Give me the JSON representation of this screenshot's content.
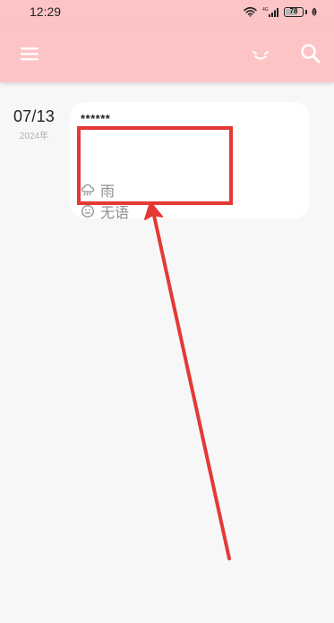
{
  "status_bar": {
    "time": "12:29",
    "network_label": "4G",
    "battery_level": "78",
    "battery_fraction": 0.78
  },
  "app_bar": {
    "background_color": "#fdc4c6"
  },
  "entry": {
    "date": "07/13",
    "year": "2024年",
    "content": "******",
    "weather": "雨",
    "mood": "无语"
  },
  "annotation": {
    "color": "#e53935"
  },
  "icons": {
    "menu": "menu-icon",
    "mood_filter": "mood-face-icon",
    "search": "search-icon",
    "weather": "cloud-rain-icon",
    "mood": "smiley-icon",
    "wifi": "wifi-icon",
    "signal": "signal-bars-icon",
    "battery": "battery-icon",
    "leaf": "leaf-icon"
  }
}
